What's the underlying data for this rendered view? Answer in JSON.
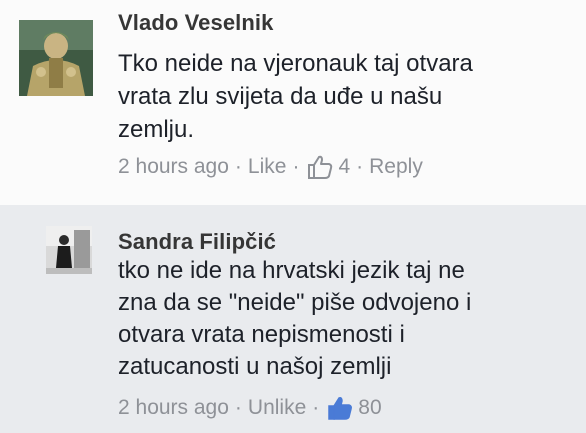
{
  "comments": [
    {
      "author": "Vlado Veselnik",
      "lines": [
        "Tko neide na vjeronauk taj otvara",
        "vrata zlu svijeta da uđe u našu",
        "zemlju."
      ],
      "time": "2 hours ago",
      "like_label": "Like",
      "like_count": "4",
      "reply_label": "Reply",
      "separator": "·"
    },
    {
      "author": "Sandra Filipčić",
      "lines": [
        "tko ne ide na hrvatski jezik taj ne",
        "zna da se \"neide\" piše odvojeno i",
        "otvara vrata nepismenosti i",
        "zatucanosti u našoj zemlji"
      ],
      "time": "2 hours ago",
      "like_label": "Unlike",
      "like_count": "80",
      "separator": "·"
    }
  ],
  "colors": {
    "like_outline": "#8e9197",
    "like_filled": "#4a7bd6",
    "name": "#363636",
    "text": "#1d2129",
    "meta": "#8e9197"
  },
  "icons": {
    "like_outline": "thumbs-up-outline-icon",
    "like_filled": "thumbs-up-filled-icon"
  }
}
